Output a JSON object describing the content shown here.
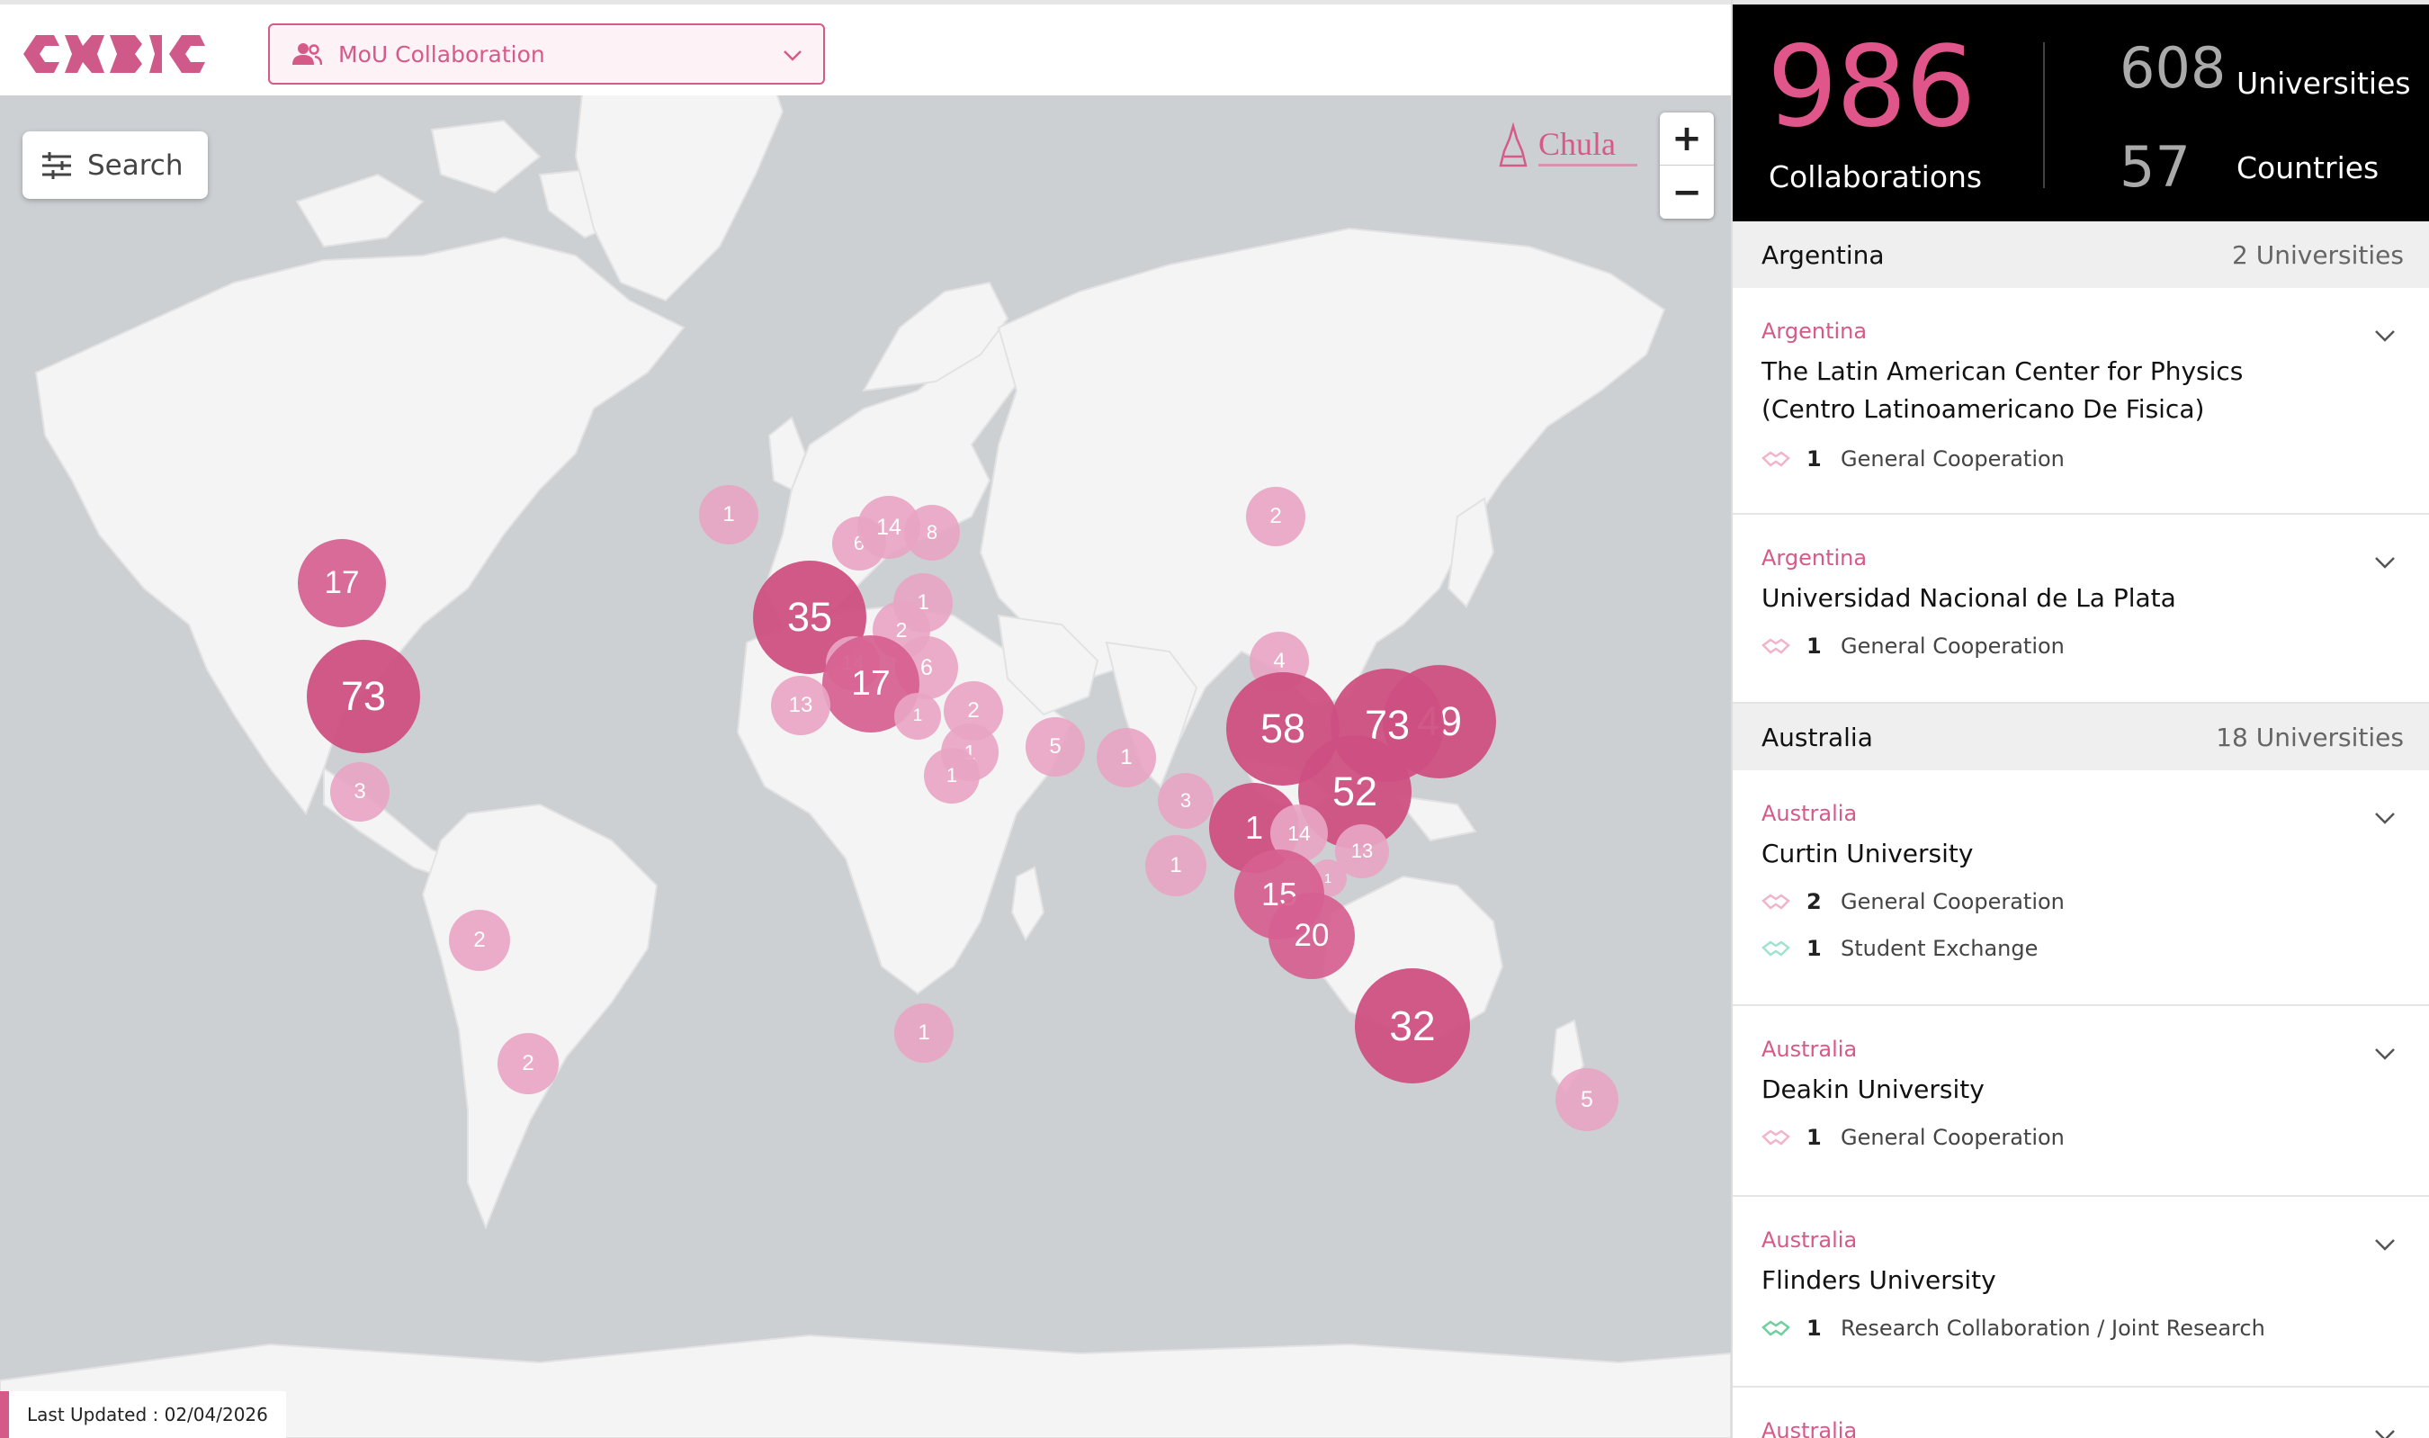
{
  "brand": {
    "logo": "CUBIC"
  },
  "header": {
    "selector_label": "MoU Collaboration"
  },
  "map": {
    "search_label": "Search",
    "zoom_in": "+",
    "zoom_out": "−",
    "watermark": "Chula",
    "last_updated": "Last Updated : 02/04/2026",
    "clusters": [
      {
        "label": "1",
        "size": "s"
      },
      {
        "label": "6",
        "size": "s"
      },
      {
        "label": "14",
        "size": "s"
      },
      {
        "label": "8",
        "size": "s"
      },
      {
        "label": "2",
        "size": "s"
      },
      {
        "label": "17",
        "size": "m"
      },
      {
        "label": "73",
        "size": "l"
      },
      {
        "label": "3",
        "size": "s"
      },
      {
        "label": "35",
        "size": "l"
      },
      {
        "label": "1",
        "size": "s"
      },
      {
        "label": "2",
        "size": "s"
      },
      {
        "label": "14",
        "size": "s"
      },
      {
        "label": "6",
        "size": "s"
      },
      {
        "label": "17",
        "size": "m"
      },
      {
        "label": "13",
        "size": "s"
      },
      {
        "label": "1",
        "size": "s"
      },
      {
        "label": "2",
        "size": "s"
      },
      {
        "label": "1",
        "size": "s"
      },
      {
        "label": "1",
        "size": "s"
      },
      {
        "label": "5",
        "size": "s"
      },
      {
        "label": "1",
        "size": "s"
      },
      {
        "label": "4",
        "size": "s"
      },
      {
        "label": "49",
        "size": "l"
      },
      {
        "label": "58",
        "size": "l"
      },
      {
        "label": "73",
        "size": "l"
      },
      {
        "label": "52",
        "size": "l"
      },
      {
        "label": "3",
        "size": "s"
      },
      {
        "label": "1",
        "size": "l"
      },
      {
        "label": "14",
        "size": "s"
      },
      {
        "label": "13",
        "size": "s"
      },
      {
        "label": "1",
        "size": "s"
      },
      {
        "label": "1",
        "size": "s"
      },
      {
        "label": "15",
        "size": "m"
      },
      {
        "label": "20",
        "size": "m"
      },
      {
        "label": "32",
        "size": "l"
      },
      {
        "label": "5",
        "size": "s"
      },
      {
        "label": "2",
        "size": "s"
      },
      {
        "label": "2",
        "size": "s"
      },
      {
        "label": "1",
        "size": "s"
      }
    ]
  },
  "stats": {
    "collaborations": "986",
    "collaborations_label": "Collaborations",
    "universities": "608",
    "universities_label": "Universities",
    "countries": "57",
    "countries_label": "Countries"
  },
  "list": {
    "groups": [
      {
        "country": "Argentina",
        "count": "2 Universities"
      },
      {
        "country": "Australia",
        "count": "18 Universities"
      }
    ],
    "cards": [
      {
        "country": "Argentina",
        "name": "The Latin American Center for Physics (Centro Latinoamericano De Fisica)",
        "rows": [
          {
            "n": "1",
            "type": "General Cooperation"
          }
        ]
      },
      {
        "country": "Argentina",
        "name": "Universidad Nacional de La Plata",
        "rows": [
          {
            "n": "1",
            "type": "General Cooperation"
          }
        ]
      },
      {
        "country": "Australia",
        "name": "Curtin University",
        "rows": [
          {
            "n": "2",
            "type": "General Cooperation"
          },
          {
            "n": "1",
            "type": "Student Exchange"
          }
        ]
      },
      {
        "country": "Australia",
        "name": "Deakin University",
        "rows": [
          {
            "n": "1",
            "type": "General Cooperation"
          }
        ]
      },
      {
        "country": "Australia",
        "name": "Flinders University",
        "rows": [
          {
            "n": "1",
            "type": "Research Collaboration / Joint Research"
          }
        ]
      },
      {
        "country": "Australia",
        "name": ""
      }
    ]
  },
  "colors": {
    "accent": "#d65a88",
    "cluster_light": "#e8a5c3",
    "cluster_dark": "#cd5082",
    "ocean": "#ccd0d3",
    "land": "#f2f2f2"
  }
}
